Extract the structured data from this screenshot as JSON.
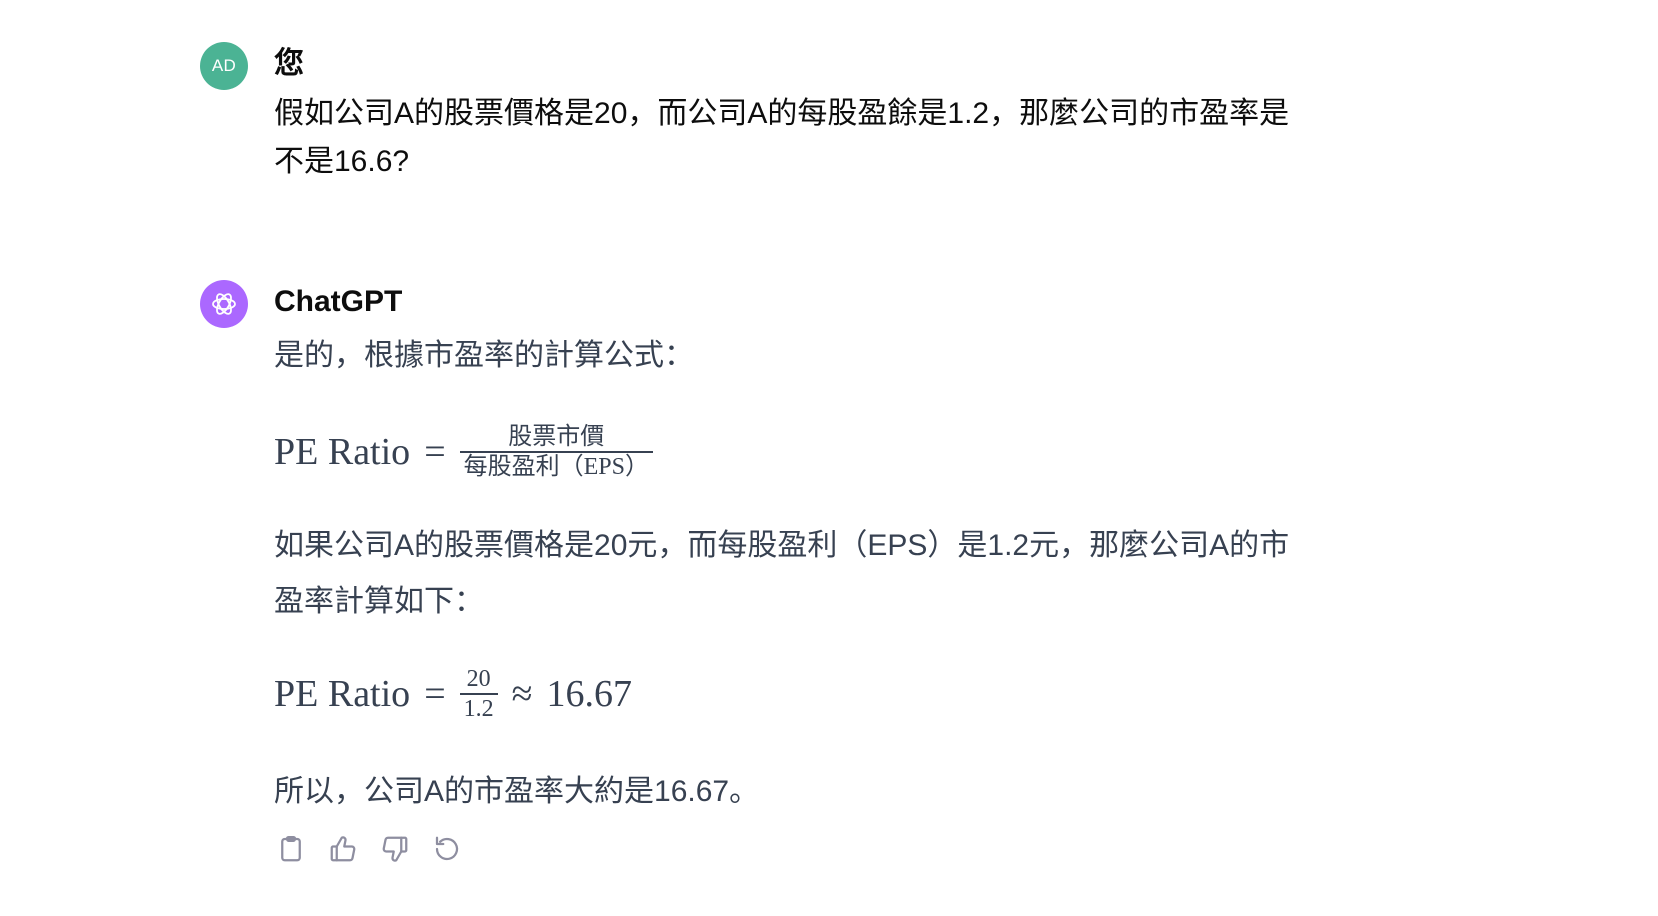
{
  "user_message": {
    "avatar_initials": "AD",
    "author": "您",
    "text": "假如公司A的股票價格是20，而公司A的每股盈餘是1.2，那麼公司的市盈率是不是16.6?"
  },
  "assistant_message": {
    "author": "ChatGPT",
    "intro": "是的，根據市盈率的計算公式：",
    "formula_1": {
      "lhs": "PE Ratio",
      "equals": "=",
      "numerator": "股票市價",
      "denominator": "每股盈利（EPS）"
    },
    "middle_paragraph": "如果公司A的股票價格是20元，而每股盈利（EPS）是1.2元，那麼公司A的市盈率計算如下：",
    "formula_2": {
      "lhs": "PE Ratio",
      "equals": "=",
      "numerator": "20",
      "denominator": "1.2",
      "approx": "≈",
      "result": "16.67"
    },
    "conclusion": "所以，公司A的市盈率大約是16.67。"
  },
  "actions": [
    "clipboard-icon",
    "thumbs-up-icon",
    "thumbs-down-icon",
    "regenerate-icon"
  ],
  "colors": {
    "user_avatar": "#4bb394",
    "gpt_avatar": "#ab68ff",
    "body_text": "#374151",
    "icon_gray": "#8e8ea0"
  }
}
